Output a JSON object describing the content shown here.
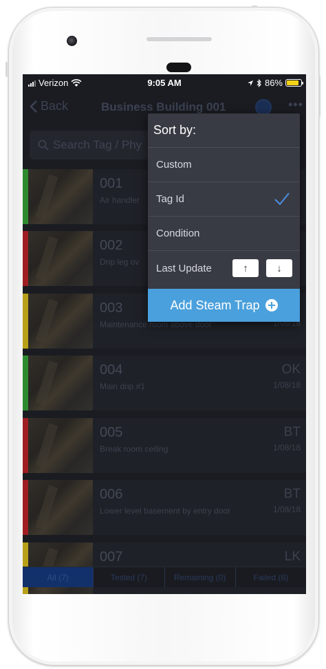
{
  "status_bar": {
    "carrier": "Verizon",
    "time": "9:05 AM",
    "battery": "86%",
    "battery_level": 0.86,
    "battery_color": "#f3d217"
  },
  "nav": {
    "back_label": "Back",
    "title": "Business Building 001",
    "more_label": "•••"
  },
  "search": {
    "placeholder": "Search Tag / Phy"
  },
  "popover": {
    "header": "Sort by:",
    "options": [
      "Custom",
      "Tag Id",
      "Condition",
      "Last Update"
    ],
    "selected": "Tag Id",
    "asc_label": "↑",
    "desc_label": "↓",
    "accent": "#4aa0dc"
  },
  "add_button": {
    "label": "Add Steam Trap"
  },
  "traps": [
    {
      "tag": "001",
      "desc": "Air handler",
      "cond": "",
      "date": "",
      "status_color": "#2f8a2f"
    },
    {
      "tag": "002",
      "desc": "Drip leg ov",
      "cond": "",
      "date": "",
      "status_color": "#a01e22"
    },
    {
      "tag": "003",
      "desc": "Maintenance room above door",
      "cond": "",
      "date": "1/08/18",
      "status_color": "#b8a019"
    },
    {
      "tag": "004",
      "desc": "Main drip #1",
      "cond": "OK",
      "date": "1/08/18",
      "status_color": "#2f8a2f"
    },
    {
      "tag": "005",
      "desc": "Break room ceiling",
      "cond": "BT",
      "date": "1/08/18",
      "status_color": "#a01e22"
    },
    {
      "tag": "006",
      "desc": "Lower level basement by entry door",
      "cond": "BT",
      "date": "1/08/18",
      "status_color": "#a01e22"
    },
    {
      "tag": "007",
      "desc": "",
      "cond": "LK",
      "date": "",
      "status_color": "#b8a019"
    }
  ],
  "filters": [
    {
      "label": "All (7)",
      "active": true
    },
    {
      "label": "Tested (7)",
      "active": false
    },
    {
      "label": "Remaining (0)",
      "active": false
    },
    {
      "label": "Failed (6)",
      "active": false
    }
  ]
}
